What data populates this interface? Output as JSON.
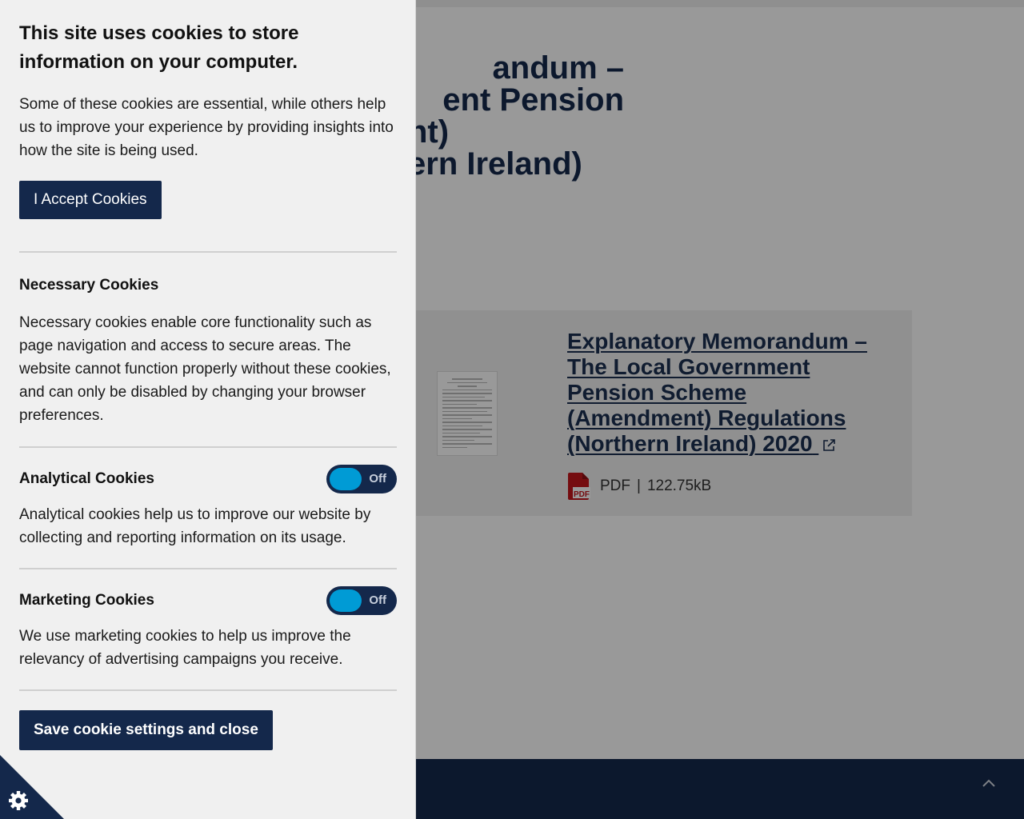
{
  "hero": {
    "title_lines": [
      "andum –",
      "ent Pension",
      "nt)",
      "ern Ireland)"
    ]
  },
  "document": {
    "link_text": "Explanatory Memorandum – The Local Government Pension Scheme (Amendment) Regulations (Northern Ireland) 2020",
    "file_type": "PDF",
    "separator": "|",
    "file_size": "122.75kB",
    "icons": [
      "pdf-icon",
      "external-link-icon"
    ]
  },
  "cookie_panel": {
    "heading": "This site uses cookies to store information on your computer.",
    "intro": "Some of these cookies are essential, while others help us to improve your experience by providing insights into how the site is being used.",
    "accept_label": "I Accept Cookies",
    "necessary": {
      "title": "Necessary Cookies",
      "text": "Necessary cookies enable core functionality such as page navigation and access to secure areas. The website cannot function properly without these cookies, and can only be disabled by changing your browser preferences."
    },
    "analytical": {
      "title": "Analytical Cookies",
      "toggle_label": "Off",
      "text": "Analytical cookies help us to improve our website by collecting and reporting information on its usage."
    },
    "marketing": {
      "title": "Marketing Cookies",
      "toggle_label": "Off",
      "text": "We use marketing cookies to help us improve the relevancy of advertising campaigns you receive."
    },
    "save_label": "Save cookie settings and close",
    "corner_icon": "gear-icon"
  },
  "footer": {
    "back_to_top_icon": "chevron-up-icon"
  },
  "colors": {
    "navy": "#14284b",
    "toggle_knob": "#009bd5",
    "panel_bg": "#f0f0f0",
    "pdf_red": "#c4161c"
  }
}
